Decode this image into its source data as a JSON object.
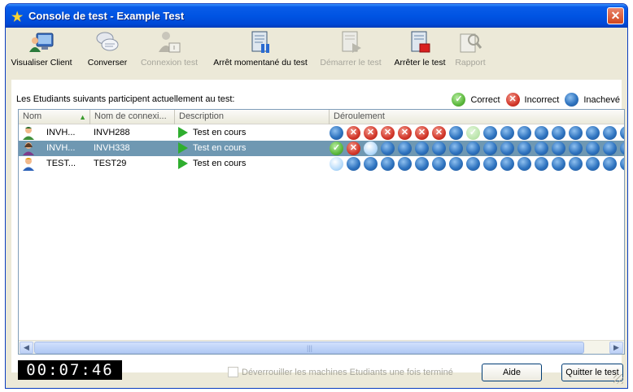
{
  "window": {
    "title": "Console de test - Example Test",
    "close_glyph": "✕"
  },
  "toolbar": [
    {
      "label": "Visualiser Client",
      "icon": "monitor-user-icon",
      "enabled": true
    },
    {
      "label": "Converser",
      "icon": "chat-bubbles-icon",
      "enabled": true
    },
    {
      "label": "Connexion test",
      "icon": "login-user-icon",
      "enabled": false
    },
    {
      "label": "Arrêt momentané du test",
      "icon": "pause-document-icon",
      "enabled": true
    },
    {
      "label": "Démarrer le test",
      "icon": "start-document-icon",
      "enabled": false
    },
    {
      "label": "Arrêter le test",
      "icon": "stop-document-icon",
      "enabled": true
    },
    {
      "label": "Rapport",
      "icon": "report-magnifier-icon",
      "enabled": false
    }
  ],
  "caption": "Les Etudiants suivants participent actuellement au test:",
  "legend": {
    "correct": "Correct",
    "incorrect": "Incorrect",
    "unfinished": "Inachevé"
  },
  "columns": {
    "name": "Nom",
    "login": "Nom de connexi...",
    "description": "Description",
    "progress": "Déroulement"
  },
  "students": [
    {
      "name": "INVH...",
      "login": "INVH288",
      "status": "Test en cours",
      "selected": false,
      "progress": [
        "p",
        "x",
        "x",
        "x",
        "x",
        "x",
        "x",
        "p",
        "cf",
        "p",
        "p",
        "p",
        "p",
        "p",
        "p",
        "p",
        "p",
        "p"
      ]
    },
    {
      "name": "INVH...",
      "login": "INVH338",
      "status": "Test en cours",
      "selected": true,
      "progress": [
        "c",
        "x",
        "cur",
        "p",
        "p",
        "p",
        "p",
        "p",
        "p",
        "p",
        "p",
        "p",
        "p",
        "p",
        "p",
        "p",
        "p",
        "p"
      ]
    },
    {
      "name": "TEST...",
      "login": "TEST29",
      "status": "Test en cours",
      "selected": false,
      "progress": [
        "cur",
        "p",
        "p",
        "p",
        "p",
        "p",
        "p",
        "p",
        "p",
        "p",
        "p",
        "p",
        "p",
        "p",
        "p",
        "p",
        "p",
        "p"
      ]
    }
  ],
  "timer": "00:07:46",
  "unlock_label": "Déverrouiller les machines Etudiants une fois terminé",
  "buttons": {
    "help": "Aide",
    "quit": "Quitter le test"
  },
  "colors": {
    "titlebar": "#0054e3",
    "selection": "#6f98b2",
    "correct": "#5bb83c",
    "incorrect": "#d2372a",
    "pending": "#2f74c0"
  }
}
